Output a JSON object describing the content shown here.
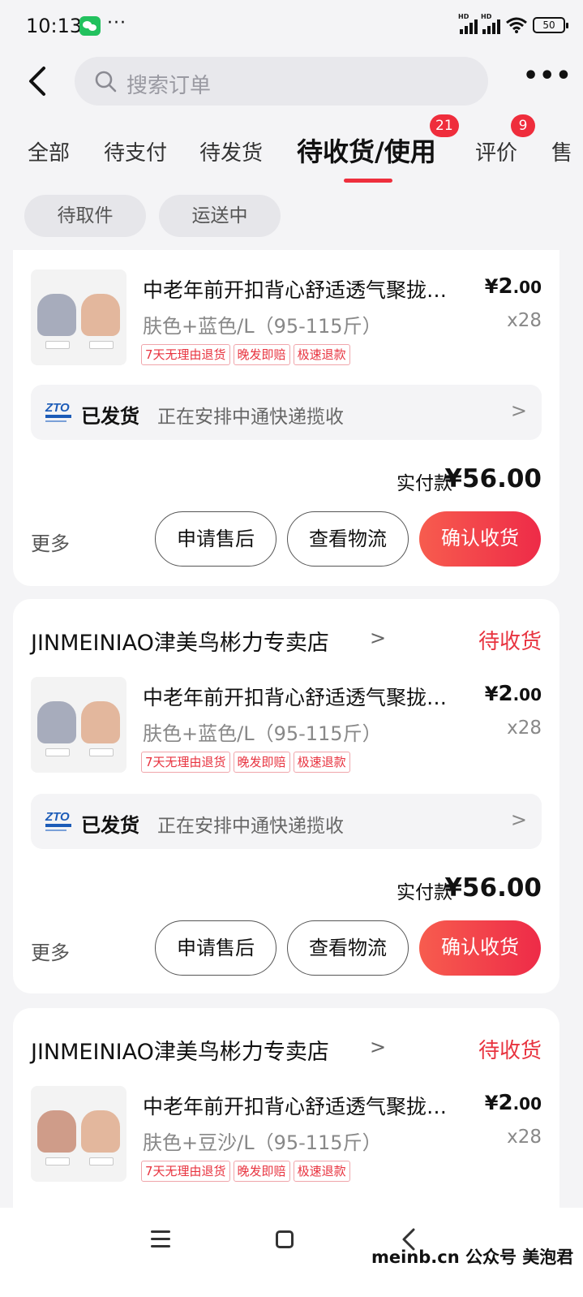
{
  "status_bar": {
    "time": "10:13",
    "dots": "···",
    "battery": "50"
  },
  "header": {
    "search_placeholder": "搜索订单"
  },
  "tabs": [
    {
      "label": "全部"
    },
    {
      "label": "待支付"
    },
    {
      "label": "待发货"
    },
    {
      "label": "待收货/使用",
      "badge": "21",
      "active": true
    },
    {
      "label": "评价",
      "badge": "9"
    },
    {
      "label": "售"
    }
  ],
  "filters": [
    {
      "label": "待取件"
    },
    {
      "label": "运送中"
    }
  ],
  "orders": [
    {
      "shop": "",
      "status": "",
      "product": {
        "title": "中老年前开扣背心舒适透气聚拢…",
        "price_symbol": "¥",
        "price_int": "2",
        "price_dec": ".00",
        "spec": "肤色+蓝色/L（95-115斤）",
        "qty": "x28",
        "tags": [
          "7天无理由退货",
          "晚发即赔",
          "极速退款"
        ],
        "thumb_labels": [
          "蓝色",
          "肤色"
        ]
      },
      "logistics": {
        "status": "已发货",
        "desc": "正在安排中通快递揽收"
      },
      "paid_label": "实付款",
      "paid_amount": "¥56.00",
      "more": "更多",
      "buttons": {
        "after_sale": "申请售后",
        "track": "查看物流",
        "confirm": "确认收货"
      }
    },
    {
      "shop": "JINMEINIAO津美鸟彬力专卖店",
      "status": "待收货",
      "product": {
        "title": "中老年前开扣背心舒适透气聚拢…",
        "price_symbol": "¥",
        "price_int": "2",
        "price_dec": ".00",
        "spec": "肤色+蓝色/L（95-115斤）",
        "qty": "x28",
        "tags": [
          "7天无理由退货",
          "晚发即赔",
          "极速退款"
        ],
        "thumb_labels": [
          "蓝色",
          "肤色"
        ]
      },
      "logistics": {
        "status": "已发货",
        "desc": "正在安排中通快递揽收"
      },
      "paid_label": "实付款",
      "paid_amount": "¥56.00",
      "more": "更多",
      "buttons": {
        "after_sale": "申请售后",
        "track": "查看物流",
        "confirm": "确认收货"
      }
    },
    {
      "shop": "JINMEINIAO津美鸟彬力专卖店",
      "status": "待收货",
      "product": {
        "title": "中老年前开扣背心舒适透气聚拢…",
        "price_symbol": "¥",
        "price_int": "2",
        "price_dec": ".00",
        "spec": "肤色+豆沙/L（95-115斤）",
        "qty": "x28",
        "tags": [
          "7天无理由退货",
          "晚发即赔",
          "极速退款"
        ],
        "thumb_labels": [
          "豆沙",
          "肤色"
        ]
      }
    }
  ],
  "watermark": "meinb.cn  公众号 美泡君",
  "colors": {
    "accent": "#ee2f3d",
    "background": "#f4f4f6",
    "card": "#ffffff"
  },
  "icons": [
    "back-arrow-icon",
    "search-icon",
    "more-dots-icon",
    "zto-logo-icon",
    "chevron-right-icon",
    "menu-icon",
    "home-icon",
    "back-nav-icon"
  ]
}
